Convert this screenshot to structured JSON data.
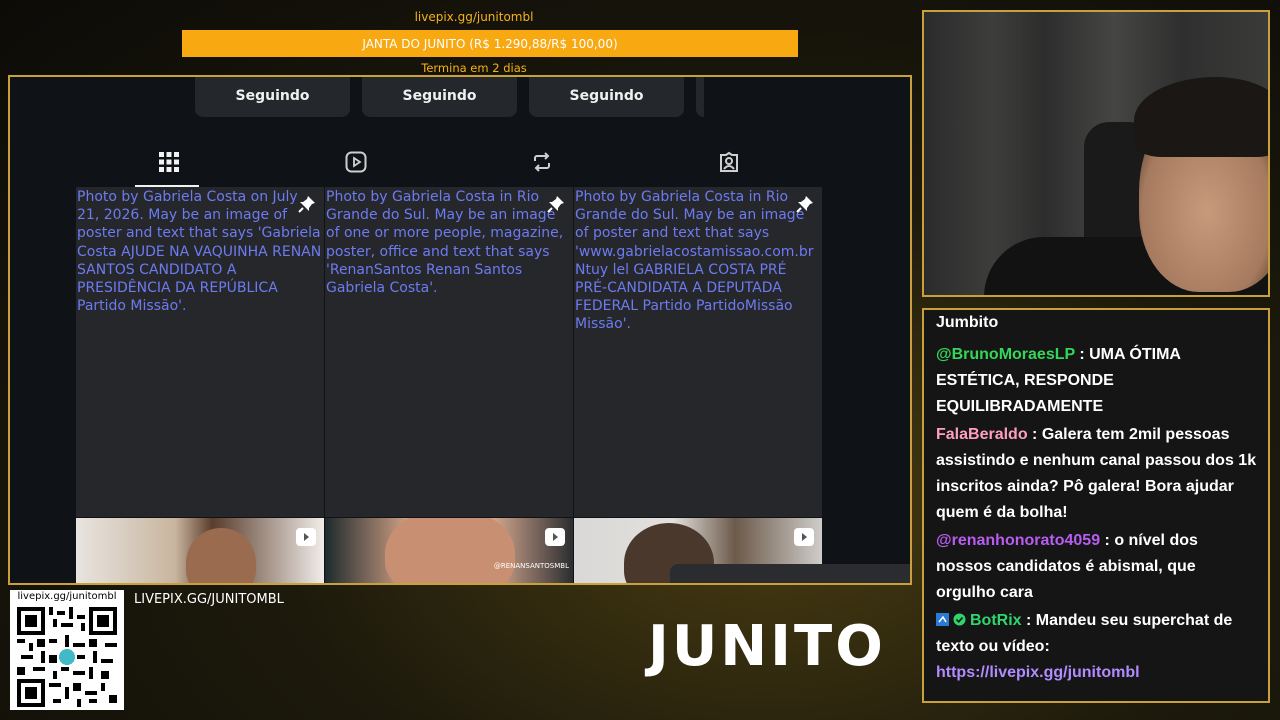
{
  "goal": {
    "url": "livepix.gg/junitombl",
    "title": "JANTA DO JUNITO (R$ 1.290,88/R$ 100,00)",
    "subtitle": "Termina em 2 dias"
  },
  "profile": {
    "follow_buttons": [
      "Seguindo",
      "Seguindo",
      "Seguindo"
    ],
    "tabs": [
      "posts-grid",
      "reels",
      "reposts",
      "tagged"
    ],
    "posts": [
      {
        "alt": "Photo by Gabriela Costa on July 21, 2026. May be an image of poster and text that says 'Gabriela Costa AJUDE NA VAQUINHA RENAN SANTOS CANDIDATO A PRESIDÊNCIA DA REPÚBLICA Partido Missão'."
      },
      {
        "alt": "Photo by Gabriela Costa in Rio Grande do Sul. May be an image of one or more people, magazine, poster, office and text that says 'RenanSantos Renan Santos Gabriela Costa'."
      },
      {
        "alt": "Photo by Gabriela Costa in Rio Grande do Sul. May be an image of poster and text that says 'www.gabrielacostamissao.com.br Ntuy lel GABRIELA COSTA PRÉ PRÉ-CANDIDATA A DEPUTADA FEDERAL Partido PartidoMissão Missão'."
      }
    ],
    "reel_watermark": "@RENANSANTOSMBL"
  },
  "chat": {
    "title": "Jumbito",
    "messages": [
      {
        "user": "@BrunoMoraesLP",
        "sep": " : ",
        "text": "UMA ÓTIMA ESTÉTICA, RESPONDE EQUILIBRADAMENTE"
      },
      {
        "user": "FalaBeraldo",
        "sep": " : ",
        "text": "Galera tem 2mil pessoas assistindo e nenhum canal passou dos 1k inscritos ainda? Pô galera! Bora ajudar quem é da bolha!"
      },
      {
        "user": "@renanhonorato4059",
        "sep": " : ",
        "text": "o nível dos nossos candidatos é abismal, que orgulho cara"
      },
      {
        "user": "BotRix",
        "sep": " : ",
        "text": "Mandeu seu superchat de texto ou vídeo:",
        "link": "https://livepix.gg/junitombl"
      }
    ]
  },
  "qr": {
    "label": "livepix.gg/junitombl"
  },
  "pix_url": "LIVEPIX.GG/JUNITOMBL",
  "brand": "JUNITO",
  "colors": {
    "accent": "#f8a810",
    "frame": "#c9a13a",
    "link": "#6c7bf0"
  }
}
